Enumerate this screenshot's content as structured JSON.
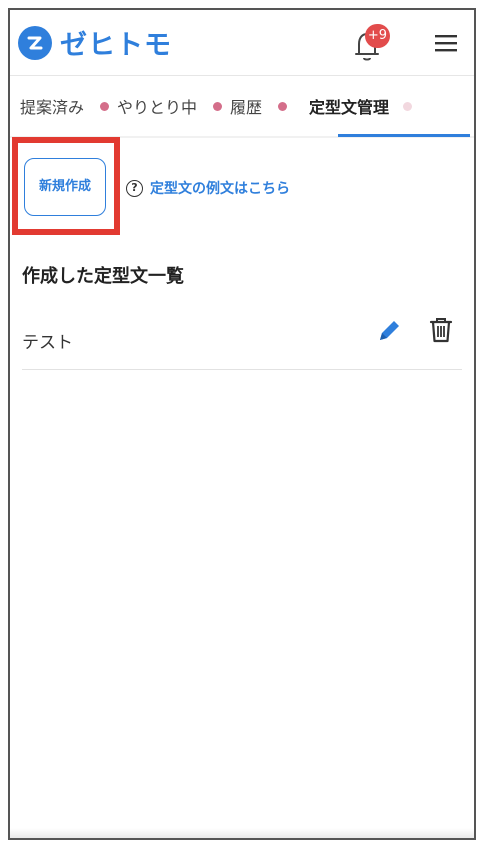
{
  "app": {
    "name": "ゼヒトモ",
    "brand_color": "#2f7fdc",
    "notification_badge": "+9"
  },
  "tabs": [
    {
      "label": "提案済み",
      "active": false
    },
    {
      "label": "やりとり中",
      "active": false
    },
    {
      "label": "履歴",
      "active": false
    },
    {
      "label": "定型文管理",
      "active": true
    }
  ],
  "actions": {
    "new_button_label": "新規作成",
    "example_link_label": "定型文の例文はこちら"
  },
  "section": {
    "title": "作成した定型文一覧"
  },
  "templates": [
    {
      "name": "テスト"
    }
  ],
  "icons": {
    "logo": "zehitomo-logo-icon",
    "notification": "bell-icon",
    "menu": "hamburger-menu-icon",
    "help": "question-circle-icon",
    "edit": "pencil-icon",
    "delete": "trash-icon"
  },
  "colors": {
    "accent": "#2f7fdc",
    "badge": "#e24c4c",
    "tab_dot": "#d46e8a",
    "highlight_frame": "#e23a31"
  }
}
